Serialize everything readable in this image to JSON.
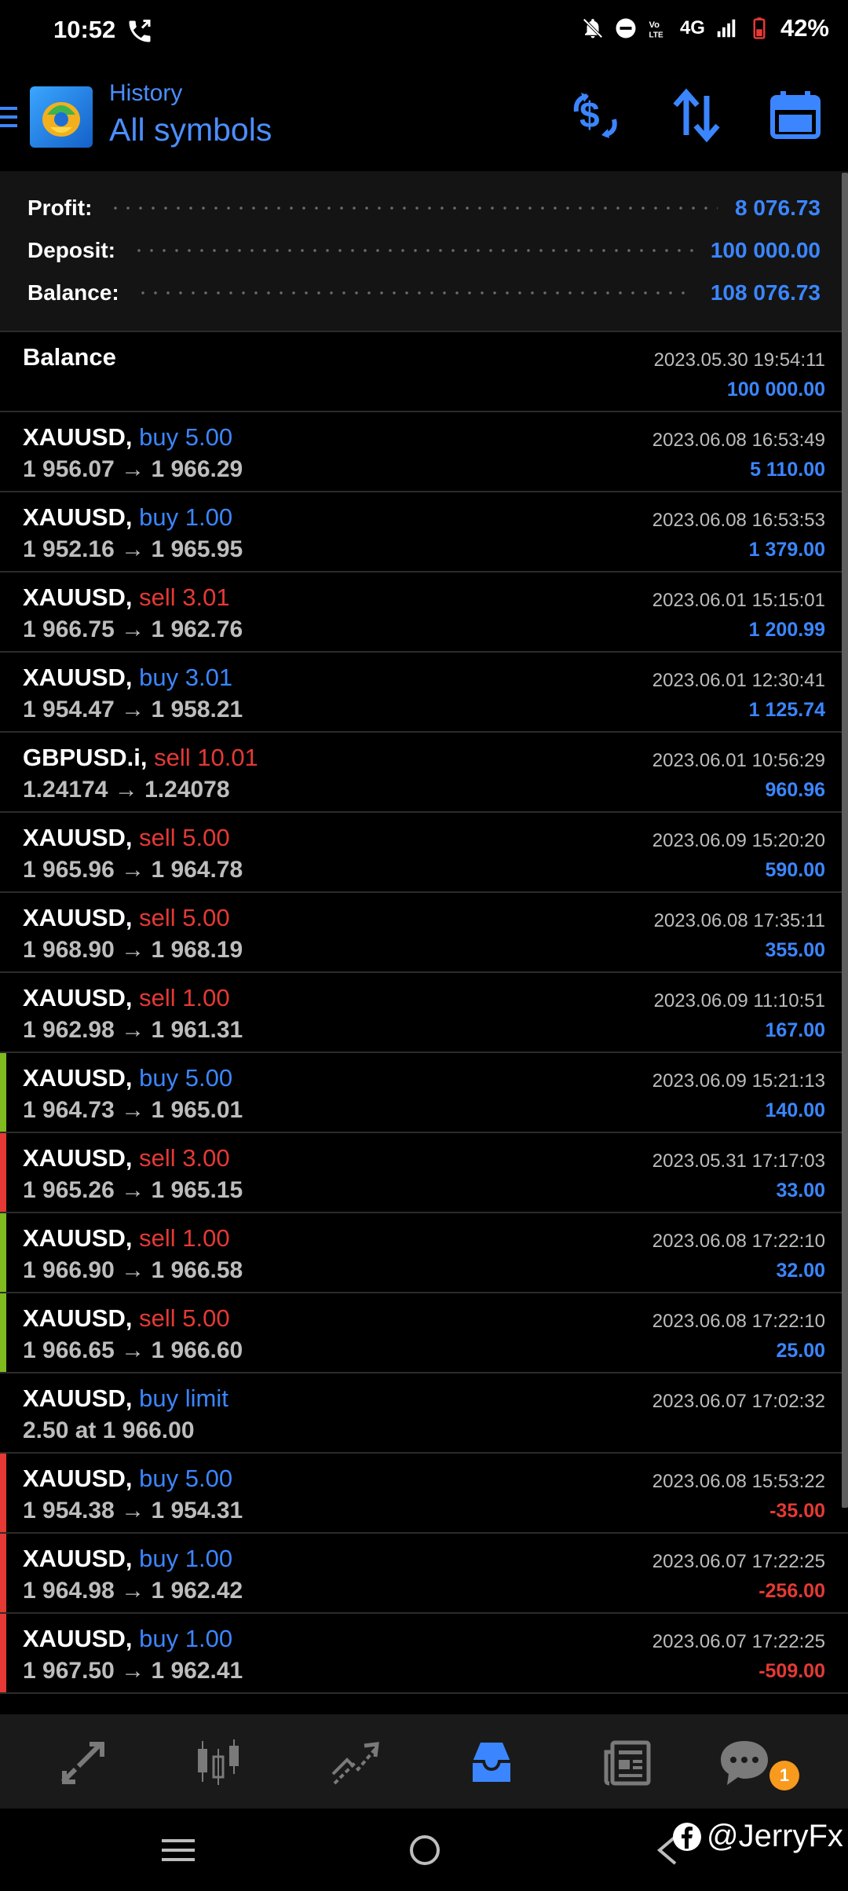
{
  "status_bar": {
    "time": "10:52",
    "network": "4G",
    "battery": "42%"
  },
  "header": {
    "subtitle": "History",
    "title": "All symbols"
  },
  "summary": [
    {
      "label": "Profit:",
      "value": "8 076.73"
    },
    {
      "label": "Deposit:",
      "value": "100 000.00"
    },
    {
      "label": "Balance:",
      "value": "108 076.73"
    }
  ],
  "balance_entry": {
    "label": "Balance",
    "date": "2023.05.30 19:54:11",
    "amount": "100 000.00"
  },
  "deals": [
    {
      "symbol": "XAUUSD,",
      "action": "buy 5.00",
      "side": "buy",
      "prices": "1 956.07 → 1 966.29",
      "date": "2023.06.08 16:53:49",
      "profit": "5 110.00",
      "sign": "pos",
      "strip": ""
    },
    {
      "symbol": "XAUUSD,",
      "action": "buy 1.00",
      "side": "buy",
      "prices": "1 952.16 → 1 965.95",
      "date": "2023.06.08 16:53:53",
      "profit": "1 379.00",
      "sign": "pos",
      "strip": ""
    },
    {
      "symbol": "XAUUSD,",
      "action": "sell 3.01",
      "side": "sell",
      "prices": "1 966.75 → 1 962.76",
      "date": "2023.06.01 15:15:01",
      "profit": "1 200.99",
      "sign": "pos",
      "strip": ""
    },
    {
      "symbol": "XAUUSD,",
      "action": "buy 3.01",
      "side": "buy",
      "prices": "1 954.47 → 1 958.21",
      "date": "2023.06.01 12:30:41",
      "profit": "1 125.74",
      "sign": "pos",
      "strip": ""
    },
    {
      "symbol": "GBPUSD.i,",
      "action": "sell 10.01",
      "side": "sell",
      "prices": "1.24174 → 1.24078",
      "date": "2023.06.01 10:56:29",
      "profit": "960.96",
      "sign": "pos",
      "strip": ""
    },
    {
      "symbol": "XAUUSD,",
      "action": "sell 5.00",
      "side": "sell",
      "prices": "1 965.96 → 1 964.78",
      "date": "2023.06.09 15:20:20",
      "profit": "590.00",
      "sign": "pos",
      "strip": ""
    },
    {
      "symbol": "XAUUSD,",
      "action": "sell 5.00",
      "side": "sell",
      "prices": "1 968.90 → 1 968.19",
      "date": "2023.06.08 17:35:11",
      "profit": "355.00",
      "sign": "pos",
      "strip": ""
    },
    {
      "symbol": "XAUUSD,",
      "action": "sell 1.00",
      "side": "sell",
      "prices": "1 962.98 → 1 961.31",
      "date": "2023.06.09 11:10:51",
      "profit": "167.00",
      "sign": "pos",
      "strip": ""
    },
    {
      "symbol": "XAUUSD,",
      "action": "buy 5.00",
      "side": "buy",
      "prices": "1 964.73 → 1 965.01",
      "date": "2023.06.09 15:21:13",
      "profit": "140.00",
      "sign": "pos",
      "strip": "#7fba1e"
    },
    {
      "symbol": "XAUUSD,",
      "action": "sell 3.00",
      "side": "sell",
      "prices": "1 965.26 → 1 965.15",
      "date": "2023.05.31 17:17:03",
      "profit": "33.00",
      "sign": "pos",
      "strip": "#e53935"
    },
    {
      "symbol": "XAUUSD,",
      "action": "sell 1.00",
      "side": "sell",
      "prices": "1 966.90 → 1 966.58",
      "date": "2023.06.08 17:22:10",
      "profit": "32.00",
      "sign": "pos",
      "strip": "#7fba1e"
    },
    {
      "symbol": "XAUUSD,",
      "action": "sell 5.00",
      "side": "sell",
      "prices": "1 966.65 → 1 966.60",
      "date": "2023.06.08 17:22:10",
      "profit": "25.00",
      "sign": "pos",
      "strip": "#7fba1e"
    },
    {
      "symbol": "XAUUSD,",
      "action": "buy limit",
      "side": "buy",
      "prices": "2.50 at 1 966.00",
      "date": "2023.06.07 17:02:32",
      "profit": "",
      "sign": "pos",
      "strip": ""
    },
    {
      "symbol": "XAUUSD,",
      "action": "buy 5.00",
      "side": "buy",
      "prices": "1 954.38 → 1 954.31",
      "date": "2023.06.08 15:53:22",
      "profit": "-35.00",
      "sign": "neg",
      "strip": "#e53935"
    },
    {
      "symbol": "XAUUSD,",
      "action": "buy 1.00",
      "side": "buy",
      "prices": "1 964.98 → 1 962.42",
      "date": "2023.06.07 17:22:25",
      "profit": "-256.00",
      "sign": "neg",
      "strip": "#e53935"
    },
    {
      "symbol": "XAUUSD,",
      "action": "buy 1.00",
      "side": "buy",
      "prices": "1 967.50 → 1 962.41",
      "date": "2023.06.07 17:22:25",
      "profit": "-509.00",
      "sign": "neg",
      "strip": "#e53935"
    }
  ],
  "bottom_nav": {
    "items": [
      "quotes-icon",
      "chart-icon",
      "trade-icon",
      "history-icon",
      "news-icon",
      "chat-icon"
    ],
    "active": "history-icon",
    "chat_badge": "1"
  },
  "watermark": "@JerryFx",
  "colors": {
    "accent": "#3b86ff",
    "sell": "#e53935",
    "profit_strip": "#7fba1e",
    "badge": "#f79a1e"
  }
}
